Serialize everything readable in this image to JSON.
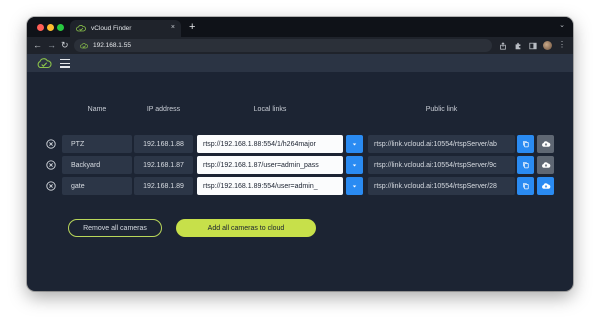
{
  "browser": {
    "tab_title": "vCloud Finder",
    "tab_close": "×",
    "new_tab": "+",
    "url": "192.168.1.55",
    "controls": {
      "back": "←",
      "forward": "→",
      "reload": "↻",
      "menu": "⋮",
      "tab_list": "⌄"
    }
  },
  "table": {
    "headers": {
      "name": "Name",
      "ip": "IP address",
      "local": "Local links",
      "public": "Public link"
    },
    "rows": [
      {
        "name": "PTZ",
        "ip": "192.168.1.88",
        "local": "rtsp://192.168.1.88:554/1/h264major",
        "public": "rtsp://link.vcloud.ai:10554/rtspServer/ab",
        "cloud_state": "disabled"
      },
      {
        "name": "Backyard",
        "ip": "192.168.1.87",
        "local": "rtsp://192.168.1.87/user=admin_pass",
        "public": "rtsp://link.vcloud.ai:10554/rtspServer/9c",
        "cloud_state": "disabled"
      },
      {
        "name": "gate",
        "ip": "192.168.1.89",
        "local": "rtsp://192.168.1.89:554/user=admin_",
        "public": "rtsp://link.vcloud.ai:10554/rtspServer/28",
        "cloud_state": "active"
      }
    ]
  },
  "actions": {
    "remove_all": "Remove all cameras",
    "add_all": "Add all cameras to cloud"
  },
  "colors": {
    "accent_blue": "#2a8bf2",
    "accent_green": "#c7e04a",
    "background": "#1c2433",
    "header": "#2b3444",
    "cloud_disabled": "#5f6773"
  },
  "icons": {
    "remove": "remove-circle-icon",
    "dropdown": "caret-down-icon",
    "copy": "copy-icon",
    "cloud_upload": "cloud-upload-icon",
    "menu": "hamburger-icon",
    "logo": "vcloud-logo-icon"
  }
}
